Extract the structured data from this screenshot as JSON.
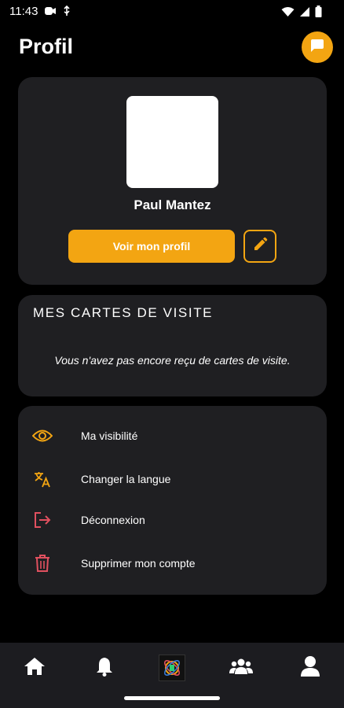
{
  "status_bar": {
    "time": "11:43",
    "icons_left": [
      "video-call-icon",
      "usb-icon"
    ],
    "icons_right": [
      "wifi-icon",
      "signal-icon",
      "battery-icon"
    ]
  },
  "header": {
    "title": "Profil",
    "chat_icon": "chat-bubble-icon"
  },
  "profile": {
    "name": "Paul Mantez",
    "view_profile_label": "Voir mon profil",
    "edit_icon": "pencil-icon"
  },
  "business_cards": {
    "title": "MES CARTES DE VISITE",
    "empty_message": "Vous n'avez pas encore reçu de cartes de visite."
  },
  "menu": {
    "items": [
      {
        "label": "Ma visibilité",
        "icon": "eye-icon"
      },
      {
        "label": "Changer la langue",
        "icon": "translate-icon"
      },
      {
        "label": "Déconnexion",
        "icon": "logout-icon"
      },
      {
        "label": "Supprimer mon compte",
        "icon": "trash-icon"
      }
    ]
  },
  "bottom_nav": {
    "items": [
      {
        "icon": "home-icon"
      },
      {
        "icon": "bell-icon"
      },
      {
        "icon": "app-logo-icon"
      },
      {
        "icon": "group-icon"
      },
      {
        "icon": "user-icon",
        "active": true
      }
    ]
  },
  "colors": {
    "accent": "#f3a512",
    "danger": "#e0505f",
    "card_bg": "#1f1f22",
    "background": "#000000"
  }
}
